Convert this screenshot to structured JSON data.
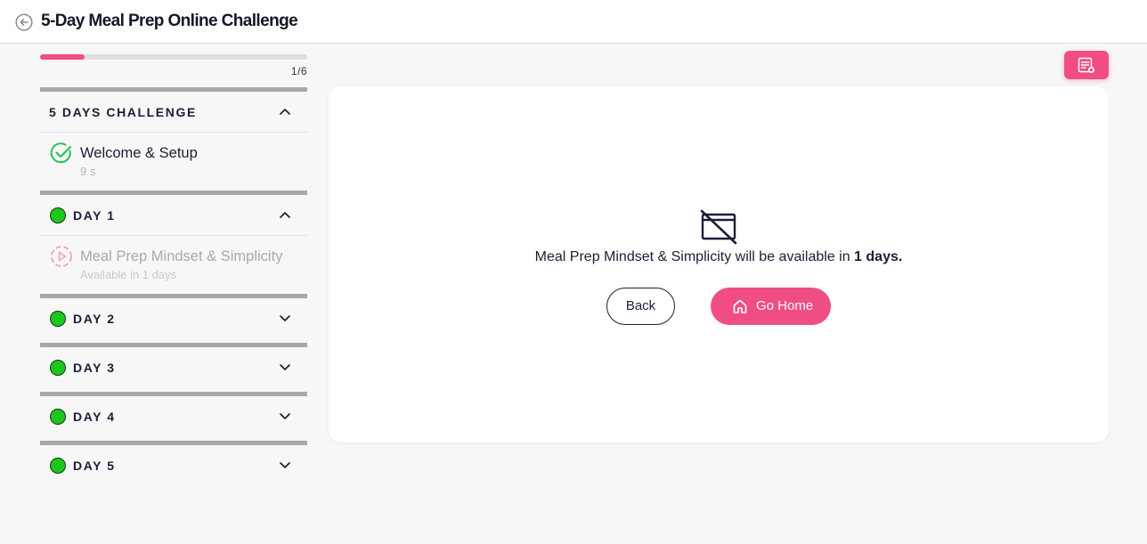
{
  "header": {
    "title": "5-Day Meal Prep Online Challenge"
  },
  "progress": {
    "count_label": "1/6",
    "fraction": 0.1667
  },
  "sidebar": {
    "sections": [
      {
        "title": "5 DAYS CHALLENGE",
        "expanded": true,
        "lessons": [
          {
            "title": "Welcome & Setup",
            "subtitle": "9 s",
            "status": "completed"
          }
        ]
      },
      {
        "title": "DAY 1",
        "expanded": true,
        "lessons": [
          {
            "title": "Meal Prep Mindset & Simplicity",
            "subtitle": "Available in 1 days",
            "status": "locked"
          }
        ]
      },
      {
        "title": "DAY 2",
        "expanded": false
      },
      {
        "title": "DAY 3",
        "expanded": false
      },
      {
        "title": "DAY 4",
        "expanded": false
      },
      {
        "title": "DAY 5",
        "expanded": false
      }
    ]
  },
  "main": {
    "message_prefix": "Meal Prep Mindset & Simplicity will be available in",
    "message_emphasis": "1 days.",
    "back_label": "Back",
    "home_label": "Go Home"
  },
  "colors": {
    "accent": "#f04d82",
    "success": "#1fc51f",
    "text": "#1a1f36",
    "muted": "#a9a9a9"
  },
  "icons": [
    "back-arrow-icon",
    "notes-icon",
    "check-circle-icon",
    "locked-play-icon",
    "chevron-up-icon",
    "chevron-down-icon",
    "unavailable-screen-icon",
    "home-icon"
  ]
}
